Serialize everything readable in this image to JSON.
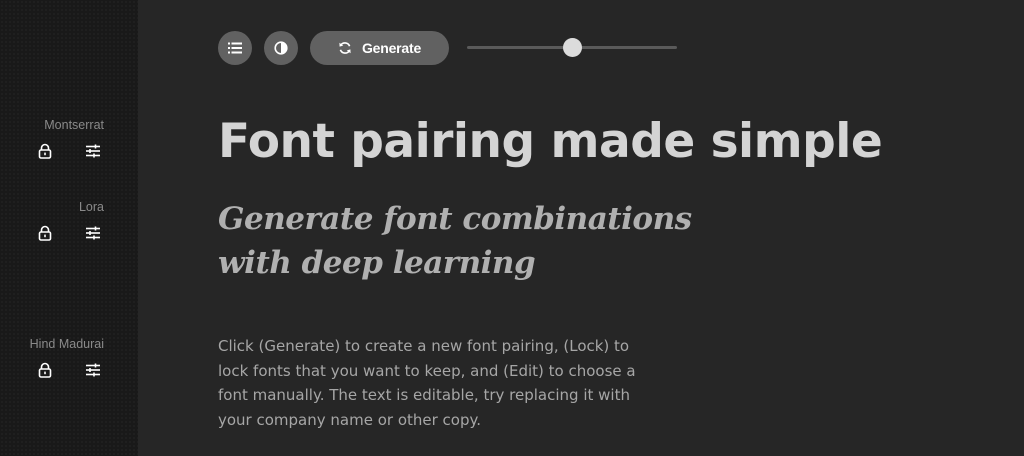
{
  "sidebar": {
    "fonts": [
      {
        "name": "Montserrat",
        "lock_icon": "lock-icon",
        "edit_icon": "sliders-icon"
      },
      {
        "name": "Lora",
        "lock_icon": "lock-icon",
        "edit_icon": "sliders-icon"
      },
      {
        "name": "Hind Madurai",
        "lock_icon": "lock-icon",
        "edit_icon": "sliders-icon"
      }
    ]
  },
  "toolbar": {
    "list_icon": "list-icon",
    "contrast_icon": "contrast-icon",
    "generate_icon": "refresh-icon",
    "generate_label": "Generate",
    "slider_value": 0.5
  },
  "content": {
    "headline": "Font pairing made simple",
    "subheading": "Generate font combinations with deep learning",
    "body": "Click (Generate) to create a new font pairing, (Lock) to lock fonts that you want to keep, and (Edit) to choose a font manually. The text is editable, try replacing it with your company name or other copy."
  },
  "colors": {
    "sidebar_bg": "#191919",
    "main_bg": "#262626",
    "button_bg": "#616161",
    "headline": "#d4d4d4"
  }
}
